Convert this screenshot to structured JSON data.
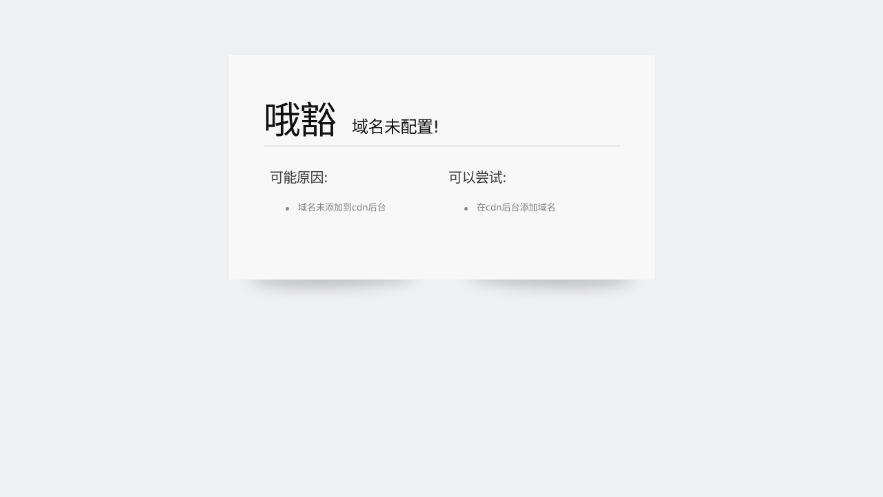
{
  "card": {
    "title": "哦豁",
    "subtitle": "域名未配置!"
  },
  "reasons": {
    "heading": "可能原因:",
    "items": [
      "域名未添加到cdn后台"
    ]
  },
  "tries": {
    "heading": "可以尝试:",
    "items": [
      "在cdn后台添加域名"
    ]
  },
  "colors": {
    "page_background": "#eff0f2",
    "card_background": "#f8f8f8",
    "title_text": "#111111",
    "list_text": "#808080",
    "divider": "#c9c9c9"
  }
}
